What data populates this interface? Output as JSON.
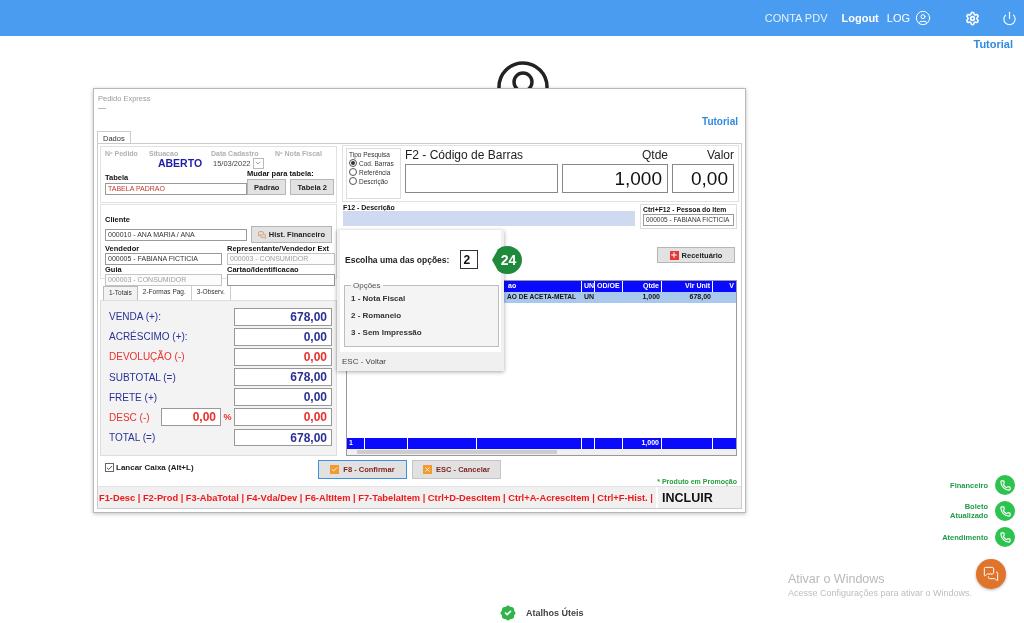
{
  "top_bar": {
    "links": [
      {
        "label": "CONTA PDV",
        "kind": "plain"
      },
      {
        "label": "Logout",
        "kind": "bold"
      },
      {
        "label": "LOG",
        "kind": "user"
      }
    ]
  },
  "tutorial_link": "Tutorial",
  "window": {
    "title": "Pedido Express",
    "subtitle": "—",
    "tutorial_link": "Tutorial",
    "tabs": [
      {
        "label": "Dados",
        "selected": true
      }
    ]
  },
  "header_info": {
    "labels": [
      "Nº Pedido",
      "Situacao",
      "Data Cadastro",
      "Nº Nota Fiscal"
    ],
    "status": "ABERTO",
    "date": "15/03/2022",
    "table_label": "Tabela",
    "table_value": "TABELA PADRAO",
    "change_label": "Mudar para tabela:",
    "change_buttons": [
      "Padrao",
      "Tabela 2"
    ]
  },
  "people": {
    "client_label": "Cliente",
    "client_value": "000010 - ANA MARIA / ANA",
    "history_button": "Hist. Financeiro",
    "fields": [
      {
        "label": "Vendedor",
        "value": "000005 - FABIANA FICTICIA",
        "disabled": false
      },
      {
        "label": "Representante/Vendedor Ext",
        "value": "000003 - CONSUMIDOR",
        "disabled": true
      },
      {
        "label": "Guia",
        "value": "000003 - CONSUMIDOR",
        "disabled": true
      },
      {
        "label": "Cartao/Identificacao",
        "disabled": false
      }
    ]
  },
  "totals_tabs": [
    {
      "label": "1-Totais",
      "selected": true
    },
    {
      "label": "2-Formas Pag.",
      "selected": false
    },
    {
      "label": "3-Observ.",
      "selected": false
    }
  ],
  "totals": [
    {
      "kind": "amount",
      "label": "VENDA (+):",
      "value": "678,00",
      "color": "#2a3196"
    },
    {
      "kind": "amount",
      "label": "ACRÉSCIMO (+):",
      "value": "0,00",
      "color": "#2a3196"
    },
    {
      "kind": "amount",
      "label": "DEVOLUÇÃO (-)",
      "value": "0,00",
      "color": "#e8302c"
    },
    {
      "kind": "amount",
      "label": "SUBTOTAL (=)",
      "value": "678,00",
      "color": "#2a3196"
    },
    {
      "kind": "amount",
      "label": "FRETE (+)",
      "value": "0,00",
      "color": "#2a3196"
    },
    {
      "kind": "percent",
      "label": "DESC (-)",
      "percent": "0,00",
      "percent_sign": "%",
      "value": "0,00",
      "color": "#e8302c"
    },
    {
      "kind": "amount",
      "label": "TOTAL  (=)",
      "value": "678,00",
      "color": "#2a3196"
    }
  ],
  "cash_checkbox": {
    "label": "Lancar Caixa (Alt+L)",
    "checked": true
  },
  "search": {
    "group_title": "Tipo Pesquisa",
    "options": [
      {
        "label": "Cod. Barras",
        "selected": true
      },
      {
        "label": "Referência",
        "selected": false
      },
      {
        "label": "Descrição",
        "selected": false
      }
    ],
    "barcode_label": "F2 - Código de Barras",
    "qty_label": "Qtde",
    "qty_value": "1,000",
    "price_label": "Valor",
    "price_value": "0,00"
  },
  "description": {
    "label": "F12 - Descrição",
    "person_label": "Ctrl+F12 - Pessoa do Item",
    "person_value": "000005 - FABIANA FICTICIA"
  },
  "prescription_button": "Receituário",
  "grid": {
    "columns": [
      "ao",
      "UN",
      "OD/OE",
      "Qtde",
      "Vlr Unit",
      "V"
    ],
    "rows": [
      {
        "description": "AO DE ACETA-METAL",
        "un": "UN",
        "qtde": "1,000",
        "vlr_unit": "678,00",
        "selected": true
      }
    ],
    "footer": {
      "count": "1",
      "qtde": "1,000"
    }
  },
  "dialog": {
    "prompt": "Escolha uma das opções:",
    "value": "2",
    "step_badge": "24",
    "group_title": "Opções",
    "options": [
      "1 - Nota Fiscal",
      "2 - Romaneio",
      "3 - Sem Impressão"
    ],
    "footer": "ESC - Voltar"
  },
  "actions": [
    {
      "label": "F8 - Confirmar",
      "kind": "confirm",
      "selected": true
    },
    {
      "label": "ESC - Cancelar",
      "kind": "cancel",
      "selected": false
    }
  ],
  "promo_note": "* Produto em Promoção",
  "shortcuts": "F1-Desc | F2-Prod | F3-AbaTotal | F4-Vda/Dev | F6-AltItem | F7-TabelaItem | Ctrl+D-DescItem | Ctrl+A-AcrescItem | Ctrl+F-Hist. |",
  "mode": "INCLUIR",
  "contacts": [
    "Financeiro",
    "Boleto Atualizado",
    "Atendimento"
  ],
  "windows_notice": {
    "title": "Ativar o Windows",
    "text": "Acesse Configurações para ativar o Windows."
  },
  "shortcuts_link": "Atalhos Úteis"
}
